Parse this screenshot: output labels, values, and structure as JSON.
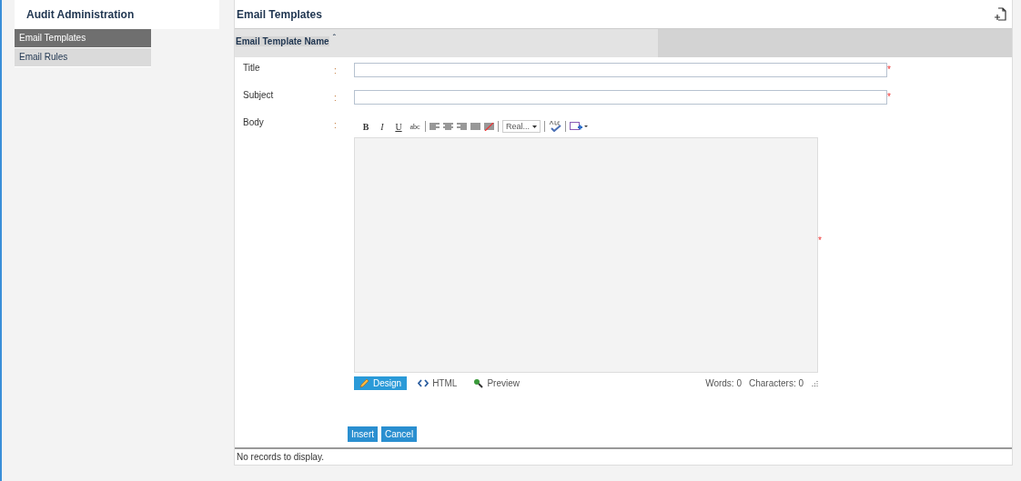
{
  "sidebar": {
    "title": "Audit Administration",
    "items": [
      {
        "label": "Email Templates",
        "selected": true
      },
      {
        "label": "Email Rules",
        "selected": false
      }
    ]
  },
  "main": {
    "title": "Email Templates",
    "grid_header": {
      "column": "Email Template Name",
      "sort_mark": "ˆ"
    },
    "form": {
      "fields": [
        {
          "label": "Title",
          "colon": ":",
          "required_mark": "*"
        },
        {
          "label": "Subject",
          "colon": ":",
          "required_mark": "*"
        }
      ],
      "body": {
        "label": "Body",
        "colon": ":",
        "required_mark": "*",
        "toolbar": {
          "format_buttons": [
            {
              "label": "B",
              "kind": "bold"
            },
            {
              "label": "I",
              "kind": "italic"
            },
            {
              "label": "U",
              "kind": "underline"
            },
            {
              "label": "abc",
              "kind": "strike"
            }
          ],
          "font_dropdown": "Real..."
        },
        "mode_tabs": [
          {
            "label": "Design",
            "kind": "design",
            "selected": true
          },
          {
            "label": "HTML",
            "kind": "html",
            "selected": false
          },
          {
            "label": "Preview",
            "kind": "preview",
            "selected": false
          }
        ],
        "words": "Words: 0",
        "characters": "Characters: 0"
      },
      "buttons": [
        "Insert",
        "Cancel"
      ]
    },
    "footer": "No records to display."
  }
}
